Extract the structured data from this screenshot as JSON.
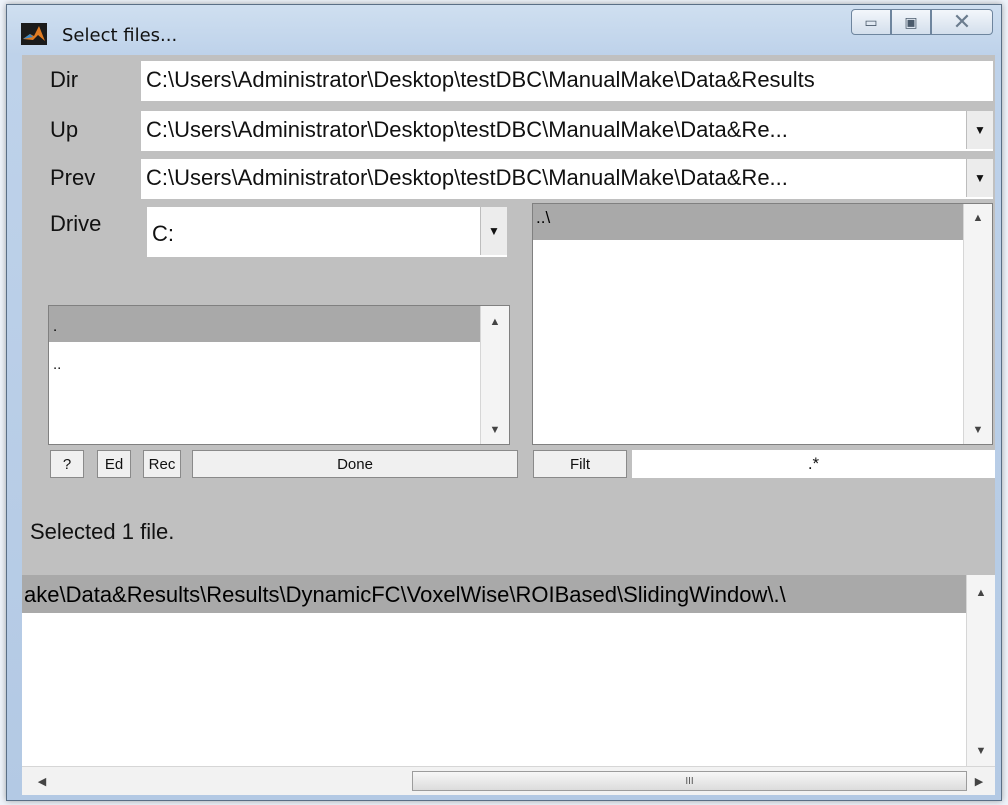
{
  "window": {
    "title": "Select files...",
    "buttons": {
      "minimize": "▭",
      "maximize": "▣",
      "close": "✕"
    }
  },
  "paths": {
    "dir_label": "Dir",
    "dir_value": "C:\\Users\\Administrator\\Desktop\\testDBC\\ManualMake\\Data&Results",
    "up_label": "Up",
    "up_value": "C:\\Users\\Administrator\\Desktop\\testDBC\\ManualMake\\Data&Re...",
    "prev_label": "Prev",
    "prev_value": "C:\\Users\\Administrator\\Desktop\\testDBC\\ManualMake\\Data&Re...",
    "drive_label": "Drive",
    "drive_value": "C:"
  },
  "dir_list": {
    "items": [
      ".",
      ".."
    ]
  },
  "file_list": {
    "items": [
      "..\\"
    ]
  },
  "buttons": {
    "help": "?",
    "edit": "Ed",
    "rec": "Rec",
    "done": "Done",
    "filter": "Filt"
  },
  "filter": {
    "value": ".*"
  },
  "status": {
    "text": "Selected 1 file."
  },
  "selected_list": {
    "items": [
      "ake\\Data&Results\\Results\\DynamicFC\\VoxelWise\\ROIBased\\SlidingWindow\\.\\"
    ]
  },
  "scroll": {
    "thumb_grip": "III"
  },
  "icons": {
    "dropdown": "chevron-down-icon",
    "scroll_up": "scroll-up-icon",
    "scroll_down": "scroll-down-icon",
    "scroll_left": "scroll-left-icon",
    "scroll_right": "scroll-right-icon",
    "app": "matlab-icon"
  }
}
